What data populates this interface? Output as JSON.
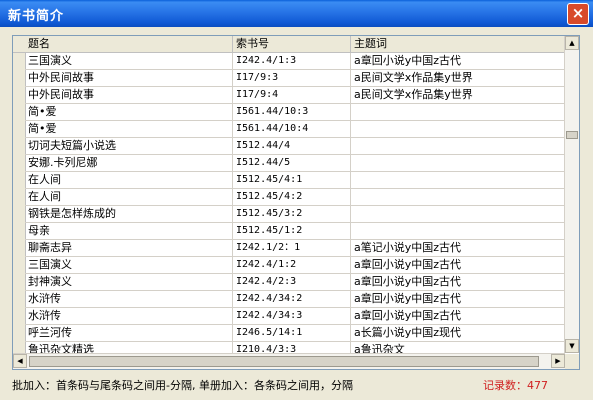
{
  "window": {
    "title": "新书简介",
    "close_glyph": "×"
  },
  "table": {
    "columns": [
      "题名",
      "索书号",
      "主题词"
    ],
    "rows": [
      [
        "三国演义",
        "I242.4/1:3",
        "a章回小说y中国z古代"
      ],
      [
        "中外民间故事",
        "I17/9:3",
        "a民间文学x作品集y世界"
      ],
      [
        "中外民间故事",
        "I17/9:4",
        "a民间文学x作品集y世界"
      ],
      [
        "简•爱",
        "I561.44/10:3",
        ""
      ],
      [
        "简•爱",
        "I561.44/10:4",
        ""
      ],
      [
        "切诃夫短篇小说选",
        "I512.44/4",
        ""
      ],
      [
        "安娜.卡列尼娜",
        "I512.44/5",
        ""
      ],
      [
        "在人间",
        "I512.45/4:1",
        ""
      ],
      [
        "在人间",
        "I512.45/4:2",
        ""
      ],
      [
        "钢铁是怎样炼成的",
        "I512.45/3:2",
        ""
      ],
      [
        "母亲",
        "I512.45/1:2",
        ""
      ],
      [
        "聊斋志异",
        "I242.1/2：1",
        "a笔记小说y中国z古代"
      ],
      [
        "三国演义",
        "I242.4/1:2",
        "a章回小说y中国z古代"
      ],
      [
        "封神演义",
        "I242.4/2:3",
        "a章回小说y中国z古代"
      ],
      [
        "水浒传",
        "I242.4/34:2",
        "a章回小说y中国z古代"
      ],
      [
        "水浒传",
        "I242.4/34:3",
        "a章回小说y中国z古代"
      ],
      [
        "呼兰河传",
        "I246.5/14:1",
        "a长篇小说y中国z现代"
      ],
      [
        "鲁迅杂文精选",
        "I210.4/3:3",
        "a鲁迅杂文"
      ]
    ]
  },
  "status": {
    "hint": "批加入：首条码与尾条码之间用-分隔, 单册加入：各条码之间用，分隔",
    "record_label": "记录数：",
    "record_count": "477"
  }
}
